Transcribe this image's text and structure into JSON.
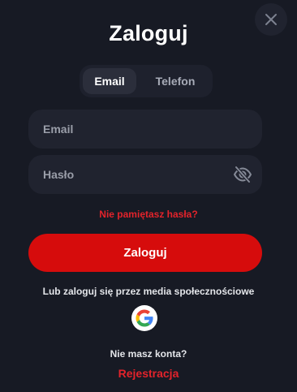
{
  "modal": {
    "title": "Zaloguj",
    "close_icon": "close-icon"
  },
  "tabs": [
    {
      "label": "Email",
      "active": true
    },
    {
      "label": "Telefon",
      "active": false
    }
  ],
  "form": {
    "email_placeholder": "Email",
    "email_value": "",
    "password_placeholder": "Hasło",
    "password_value": "",
    "password_toggle_icon": "eye-off-icon",
    "forgot_password": "Nie pamiętasz hasła?",
    "submit_label": "Zaloguj"
  },
  "social": {
    "text": "Lub zaloguj się przez media społecznościowe",
    "providers": [
      "google-icon"
    ]
  },
  "register": {
    "prompt": "Nie masz konta?",
    "link": "Rejestracja"
  },
  "colors": {
    "background": "#171a24",
    "field": "#20232f",
    "accent": "#d60c0c",
    "link": "#e3232b"
  }
}
